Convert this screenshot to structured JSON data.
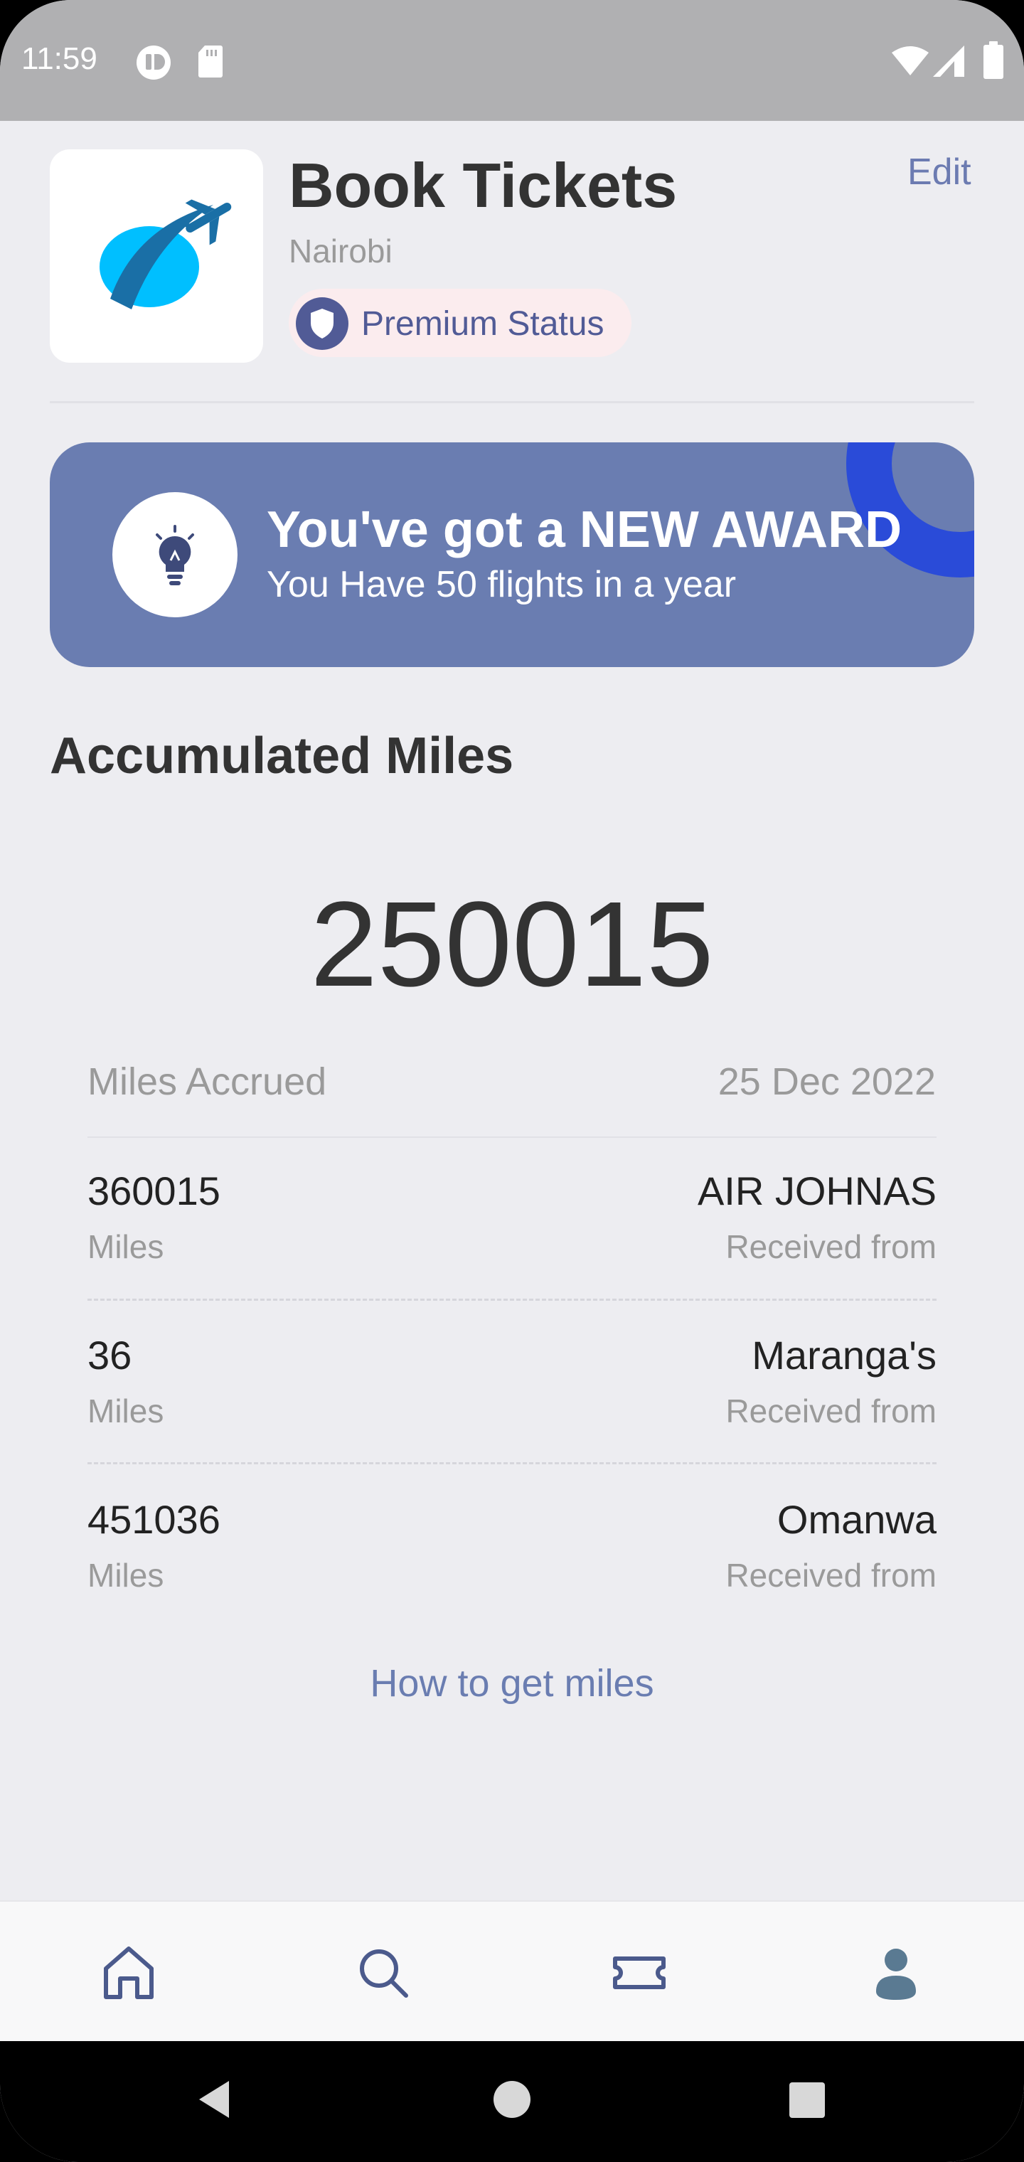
{
  "status_bar": {
    "time": "11:59",
    "icons": [
      "app-notification-icon",
      "sd-card-icon",
      "wifi-icon",
      "cell-signal-icon",
      "battery-icon"
    ]
  },
  "header": {
    "title": "Book Tickets",
    "subtitle": "Nairobi",
    "edit_label": "Edit",
    "badge_label": "Premium Status",
    "logo_icon": "plane-logo-icon"
  },
  "award": {
    "title": "You've got a NEW AWARD",
    "subtitle": "You Have 50 flights in a year",
    "icon": "lightbulb-icon"
  },
  "accumulated": {
    "title": "Accumulated Miles",
    "total": "250015",
    "accrued_label": "Miles Accrued",
    "accrued_date": "25 Dec 2022",
    "rows": [
      {
        "value": "360015",
        "unit": "Miles",
        "source": "AIR JOHNAS",
        "note": "Received from"
      },
      {
        "value": "36",
        "unit": "Miles",
        "source": "Maranga's",
        "note": "Received from"
      },
      {
        "value": "451036",
        "unit": "Miles",
        "source": "Omanwa",
        "note": "Received from"
      }
    ],
    "howto_label": "How to get miles"
  },
  "bottom_nav": {
    "items": [
      "home-icon",
      "search-icon",
      "ticket-icon",
      "profile-icon"
    ]
  },
  "colors": {
    "accent": "#6a7db1",
    "badge_text": "#515b96",
    "badge_bg": "#fbecee",
    "ring": "#2a4bd8",
    "logo_cyan": "#00bfff",
    "logo_dark": "#1a6fa6"
  }
}
